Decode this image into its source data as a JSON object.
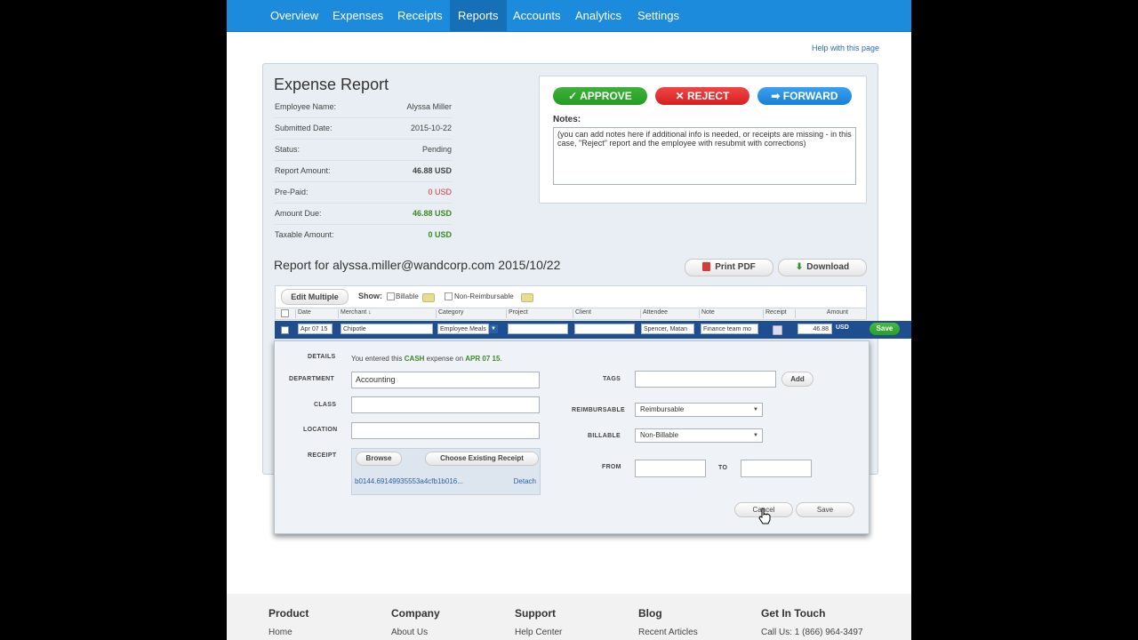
{
  "nav": {
    "items": [
      "Overview",
      "Expenses",
      "Receipts",
      "Reports",
      "Accounts",
      "Analytics",
      "Settings"
    ],
    "active": "Reports"
  },
  "help_link": "Help with this page",
  "summary": {
    "title": "Expense Report",
    "employee_name_label": "Employee Name:",
    "employee_name": "Alyssa Miller",
    "submitted_date_label": "Submitted Date:",
    "submitted_date": "2015-10-22",
    "status_label": "Status:",
    "status": "Pending",
    "report_amount_label": "Report Amount:",
    "report_amount": "46.88 USD",
    "prepaid_label": "Pre-Paid:",
    "prepaid": "0 USD",
    "amount_due_label": "Amount Due:",
    "amount_due": "46.88 USD",
    "taxable_amount_label": "Taxable Amount:",
    "taxable_amount": "0 USD"
  },
  "approval": {
    "approve_label": "APPROVE",
    "reject_label": "REJECT",
    "forward_label": "FORWARD",
    "notes_label": "Notes:",
    "notes_value": "(you can add notes here if additional info is needed, or receipts are missing - in this case, \"Reject\" report and the employee with resubmit with corrections)"
  },
  "report": {
    "title": "Report for alyssa.miller@wandcorp.com 2015/10/22",
    "print_pdf_label": "Print PDF",
    "download_label": "Download"
  },
  "toolbar": {
    "edit_multiple_label": "Edit Multiple",
    "show_label": "Show:",
    "billable_label": "Billable",
    "non_reimbursable_label": "Non-Reimbursable"
  },
  "table": {
    "headers": {
      "date": "Date",
      "merchant": "Merchant ↓",
      "category": "Category",
      "project": "Project",
      "client": "Client",
      "attendee": "Attendee",
      "note": "Note",
      "receipt": "Receipt",
      "amount": "Amount"
    },
    "row": {
      "date": "Apr 07 15",
      "merchant": "Chipotle",
      "category": "Employee Meals",
      "project": "",
      "client": "",
      "attendee": "Spencer, Matan",
      "note": "Finance team mo",
      "amount": "46.88",
      "currency": "USD",
      "save_label": "Save"
    }
  },
  "details": {
    "details_label": "DETAILS",
    "details_prefix": "You entered this",
    "payment_type": "CASH",
    "details_mid": "expense on",
    "details_date": "APR 07 15",
    "details_suffix": ".",
    "department_label": "DEPARTMENT",
    "department_value": "Accounting",
    "class_label": "CLASS",
    "class_value": "",
    "location_label": "LOCATION",
    "location_value": "",
    "receipt_label": "RECEIPT",
    "browse_label": "Browse",
    "choose_existing_label": "Choose Existing Receipt",
    "receipt_file": "b0144.69149935553a4cfb1b016...",
    "detach_label": "Detach",
    "tags_label": "TAGS",
    "tags_value": "",
    "add_label": "Add",
    "reimbursable_label": "REIMBURSABLE",
    "reimbursable_value": "Reimbursable",
    "billable_label": "BILLABLE",
    "billable_value": "Non-Billable",
    "from_label": "FROM",
    "from_value": "",
    "to_label": "TO",
    "to_value": "",
    "cancel_label": "Cancel",
    "save_label": "Save"
  },
  "footer": {
    "product": {
      "heading": "Product",
      "link": "Home"
    },
    "company": {
      "heading": "Company",
      "link": "About Us"
    },
    "support": {
      "heading": "Support",
      "link": "Help Center"
    },
    "blog": {
      "heading": "Blog",
      "link": "Recent Articles"
    },
    "contact": {
      "heading": "Get In Touch",
      "link": "Call Us: 1 (866) 964-3497"
    }
  },
  "colors": {
    "nav": "#1c8bdb",
    "approve": "#2aa326",
    "reject": "#e02a2a",
    "forward": "#1f8ae0",
    "edit_row": "#1e4e8f"
  }
}
